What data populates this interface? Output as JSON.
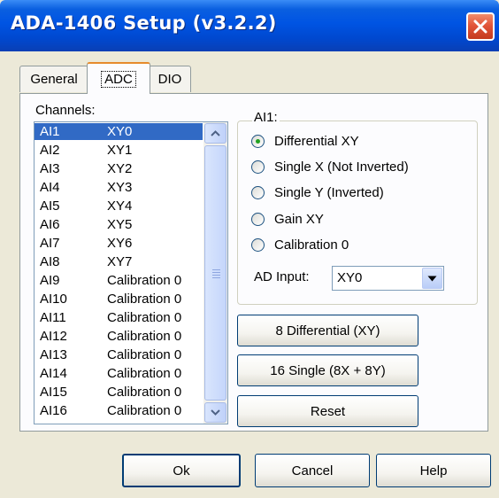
{
  "window": {
    "title": "ADA-1406 Setup (v3.2.2)"
  },
  "tabs": [
    {
      "label": "General"
    },
    {
      "label": "ADC"
    },
    {
      "label": "DIO"
    }
  ],
  "channels": {
    "label": "Channels:",
    "items": [
      {
        "ch": "AI1",
        "map": "XY0",
        "selected": true
      },
      {
        "ch": "AI2",
        "map": "XY1"
      },
      {
        "ch": "AI3",
        "map": "XY2"
      },
      {
        "ch": "AI4",
        "map": "XY3"
      },
      {
        "ch": "AI5",
        "map": "XY4"
      },
      {
        "ch": "AI6",
        "map": "XY5"
      },
      {
        "ch": "AI7",
        "map": "XY6"
      },
      {
        "ch": "AI8",
        "map": "XY7"
      },
      {
        "ch": "AI9",
        "map": "Calibration 0"
      },
      {
        "ch": "AI10",
        "map": "Calibration 0"
      },
      {
        "ch": "AI11",
        "map": "Calibration 0"
      },
      {
        "ch": "AI12",
        "map": "Calibration 0"
      },
      {
        "ch": "AI13",
        "map": "Calibration 0"
      },
      {
        "ch": "AI14",
        "map": "Calibration 0"
      },
      {
        "ch": "AI15",
        "map": "Calibration 0"
      },
      {
        "ch": "AI16",
        "map": "Calibration 0"
      }
    ]
  },
  "group": {
    "caption": "AI1:",
    "options": [
      {
        "label": "Differential XY",
        "checked": true
      },
      {
        "label": "Single X (Not Inverted)",
        "checked": false
      },
      {
        "label": "Single Y (Inverted)",
        "checked": false
      },
      {
        "label": "Gain XY",
        "checked": false
      },
      {
        "label": "Calibration 0",
        "checked": false
      }
    ],
    "ad_input_label": "AD Input:",
    "ad_input_value": "XY0"
  },
  "buttons": {
    "differential": "8 Differential (XY)",
    "single": "16 Single (8X + 8Y)",
    "reset": "Reset",
    "ok": "Ok",
    "cancel": "Cancel",
    "help": "Help"
  },
  "colors": {
    "title_bar": "#0054e3",
    "selection": "#316ac5",
    "dialog_bg": "#ece9d8",
    "active_tab_accent": "#e68b2c",
    "radio_check": "#21a121"
  },
  "icons": {
    "close": "close-icon",
    "scroll_up": "scroll-up-arrow-icon",
    "scroll_down": "scroll-down-arrow-icon",
    "dropdown": "dropdown-arrow-icon"
  }
}
